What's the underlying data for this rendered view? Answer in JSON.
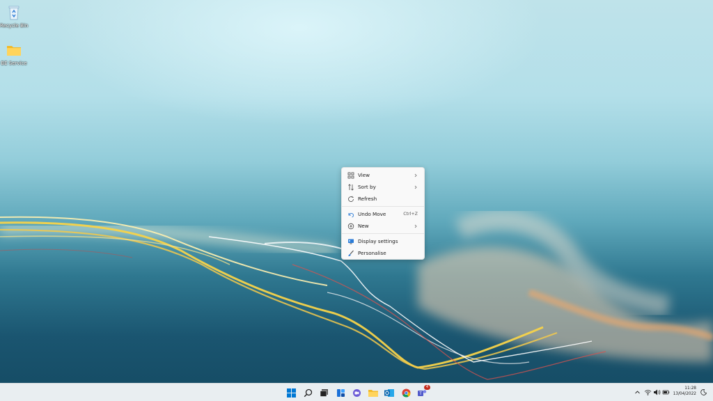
{
  "desktop": {
    "icons": [
      {
        "label": "Recycle Bin",
        "icon": "recycle-bin-icon"
      },
      {
        "label": "BE Service",
        "icon": "folder-icon"
      }
    ]
  },
  "context_menu": {
    "items": [
      {
        "label": "View",
        "icon": "view-grid-icon",
        "submenu": true
      },
      {
        "label": "Sort by",
        "icon": "sort-icon",
        "submenu": true
      },
      {
        "label": "Refresh",
        "icon": "refresh-icon"
      },
      {
        "label": "Undo Move",
        "icon": "undo-icon",
        "shortcut": "Ctrl+Z"
      },
      {
        "label": "New",
        "icon": "new-plus-icon",
        "submenu": true
      },
      {
        "label": "Display settings",
        "icon": "display-settings-icon"
      },
      {
        "label": "Personalise",
        "icon": "personalise-brush-icon"
      }
    ]
  },
  "taskbar": {
    "apps": [
      "start-icon",
      "search-icon",
      "task-view-icon",
      "widgets-icon",
      "chat-icon",
      "file-explorer-icon",
      "outlook-icon",
      "chrome-icon",
      "teams-icon"
    ],
    "teams_badge": "4",
    "clock": {
      "time": "11:28",
      "date": "13/04/2022"
    }
  },
  "colors": {
    "accent": "#0067c0",
    "menu_bg": "#f9f9f9",
    "taskbar_bg": "#e9eef1"
  }
}
